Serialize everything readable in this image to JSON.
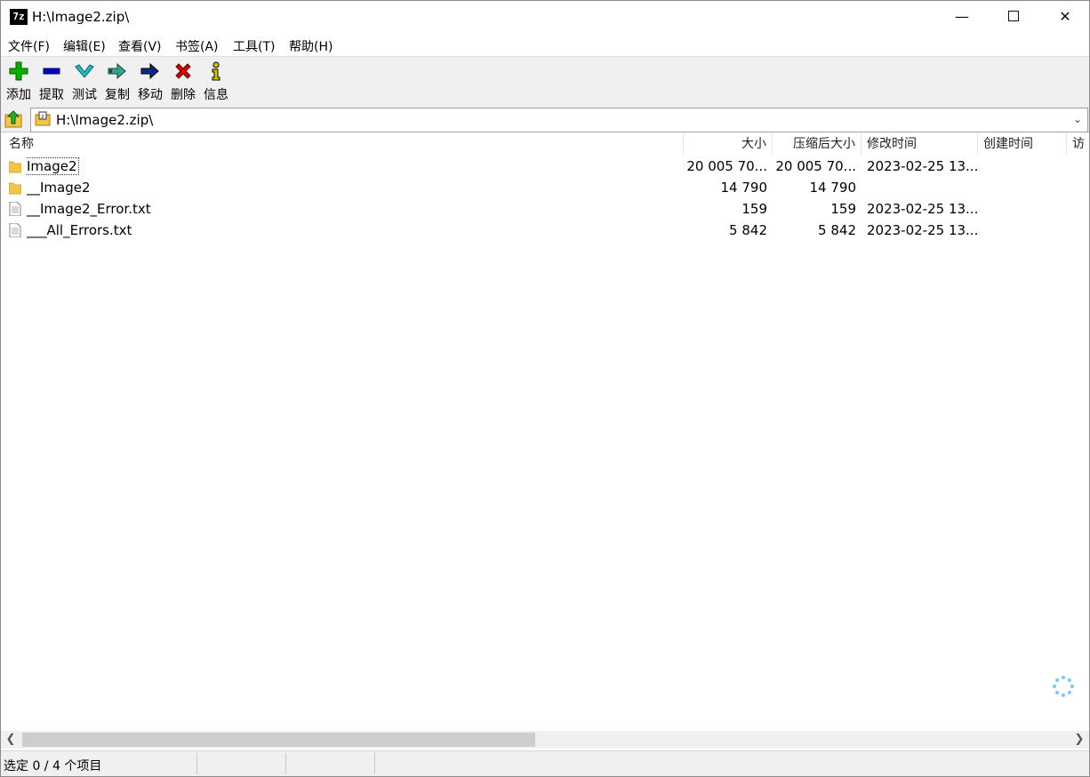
{
  "window": {
    "title": "H:\\Image2.zip\\",
    "app_icon_text": "7z",
    "minimize": "—",
    "close": "✕"
  },
  "menu": [
    "文件(F)",
    "编辑(E)",
    "查看(V)",
    "书签(A)",
    "工具(T)",
    "帮助(H)"
  ],
  "toolbar": [
    {
      "label": "添加",
      "icon": "add-icon"
    },
    {
      "label": "提取",
      "icon": "extract-icon"
    },
    {
      "label": "测试",
      "icon": "test-icon"
    },
    {
      "label": "复制",
      "icon": "copy-icon"
    },
    {
      "label": "移动",
      "icon": "move-icon"
    },
    {
      "label": "删除",
      "icon": "delete-icon"
    },
    {
      "label": "信息",
      "icon": "info-icon"
    }
  ],
  "address": {
    "path": "H:\\Image2.zip\\"
  },
  "columns": [
    "名称",
    "大小",
    "压缩后大小",
    "修改时间",
    "创建时间",
    "访"
  ],
  "files": [
    {
      "name": "Image2",
      "type": "folder",
      "size": "20 005 70...",
      "packed": "20 005 70...",
      "modified": "2023-02-25 13..."
    },
    {
      "name": "__Image2",
      "type": "folder",
      "size": "14 790",
      "packed": "14 790",
      "modified": ""
    },
    {
      "name": "__Image2_Error.txt",
      "type": "file",
      "size": "159",
      "packed": "159",
      "modified": "2023-02-25 13..."
    },
    {
      "name": "___All_Errors.txt",
      "type": "file",
      "size": "5 842",
      "packed": "5 842",
      "modified": "2023-02-25 13..."
    }
  ],
  "status": {
    "selection": "选定 0 / 4 个项目"
  },
  "colors": {
    "toolbar_bg": "#f0f0f0",
    "folder": "#f3c64b",
    "add": "#00b000",
    "extract": "#0000c8",
    "test": "#20c0c0",
    "move": "#0a2a8a",
    "delete": "#d00000",
    "info": "#d4c400"
  }
}
